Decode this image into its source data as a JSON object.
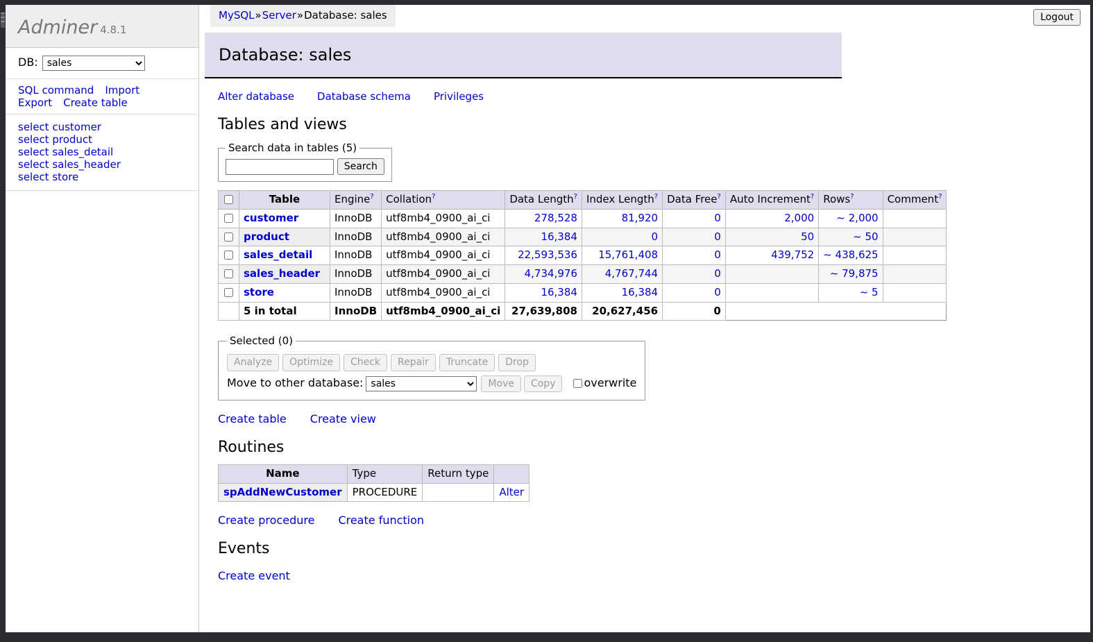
{
  "breadcrumb": {
    "server_type": "MySQL",
    "server": "Server",
    "separator": "»",
    "current": "Database: sales"
  },
  "logout_label": "Logout",
  "sidebar": {
    "logo_name": "Adminer",
    "logo_version": "4.8.1",
    "db_label": "DB:",
    "db_selected": "sales",
    "db_options": [
      "sales"
    ],
    "actions": [
      {
        "label": "SQL command"
      },
      {
        "label": "Import"
      },
      {
        "label": "Export"
      },
      {
        "label": "Create table"
      }
    ],
    "table_links": [
      {
        "label": "select customer"
      },
      {
        "label": "select product"
      },
      {
        "label": "select sales_detail"
      },
      {
        "label": "select sales_header"
      },
      {
        "label": "select store"
      }
    ]
  },
  "main": {
    "page_title": "Database: sales",
    "db_links": [
      {
        "label": "Alter database"
      },
      {
        "label": "Database schema"
      },
      {
        "label": "Privileges"
      }
    ],
    "tables_heading": "Tables and views",
    "search": {
      "legend": "Search data in tables (5)",
      "value": "",
      "button": "Search"
    },
    "tables_table": {
      "headers": [
        {
          "label": "Table",
          "help": false
        },
        {
          "label": "Engine",
          "help": true
        },
        {
          "label": "Collation",
          "help": true
        },
        {
          "label": "Data Length",
          "help": true
        },
        {
          "label": "Index Length",
          "help": true
        },
        {
          "label": "Data Free",
          "help": true
        },
        {
          "label": "Auto Increment",
          "help": true
        },
        {
          "label": "Rows",
          "help": true
        },
        {
          "label": "Comment",
          "help": true
        }
      ],
      "rows": [
        {
          "name": "customer",
          "engine": "InnoDB",
          "collation": "utf8mb4_0900_ai_ci",
          "data_length": "278,528",
          "index_length": "81,920",
          "data_free": "0",
          "auto_increment": "2,000",
          "rows": "~ 2,000",
          "comment": ""
        },
        {
          "name": "product",
          "engine": "InnoDB",
          "collation": "utf8mb4_0900_ai_ci",
          "data_length": "16,384",
          "index_length": "0",
          "data_free": "0",
          "auto_increment": "50",
          "rows": "~ 50",
          "comment": ""
        },
        {
          "name": "sales_detail",
          "engine": "InnoDB",
          "collation": "utf8mb4_0900_ai_ci",
          "data_length": "22,593,536",
          "index_length": "15,761,408",
          "data_free": "0",
          "auto_increment": "439,752",
          "rows": "~ 438,625",
          "comment": ""
        },
        {
          "name": "sales_header",
          "engine": "InnoDB",
          "collation": "utf8mb4_0900_ai_ci",
          "data_length": "4,734,976",
          "index_length": "4,767,744",
          "data_free": "0",
          "auto_increment": "",
          "rows": "~ 79,875",
          "comment": ""
        },
        {
          "name": "store",
          "engine": "InnoDB",
          "collation": "utf8mb4_0900_ai_ci",
          "data_length": "16,384",
          "index_length": "16,384",
          "data_free": "0",
          "auto_increment": "",
          "rows": "~ 5",
          "comment": ""
        }
      ],
      "total": {
        "name": "5 in total",
        "engine": "InnoDB",
        "collation": "utf8mb4_0900_ai_ci",
        "data_length": "27,639,808",
        "index_length": "20,627,456",
        "data_free": "0"
      }
    },
    "selected": {
      "legend": "Selected (0)",
      "buttons": [
        "Analyze",
        "Optimize",
        "Check",
        "Repair",
        "Truncate",
        "Drop"
      ],
      "move_label": "Move to other database:",
      "move_selected": "sales",
      "move_options": [
        "sales"
      ],
      "move_button": "Move",
      "copy_button": "Copy",
      "overwrite_label": "overwrite"
    },
    "create_links": [
      {
        "label": "Create table"
      },
      {
        "label": "Create view"
      }
    ],
    "routines_heading": "Routines",
    "routines_table": {
      "headers": [
        "Name",
        "Type",
        "Return type",
        ""
      ],
      "rows": [
        {
          "name": "spAddNewCustomer",
          "type": "PROCEDURE",
          "return_type": "",
          "action": "Alter"
        }
      ]
    },
    "routine_links": [
      {
        "label": "Create procedure"
      },
      {
        "label": "Create function"
      }
    ],
    "events_heading": "Events",
    "event_links": [
      {
        "label": "Create event"
      }
    ]
  },
  "colors": {
    "accent_orange": "#e8602c",
    "header_lavender": "#ddddee",
    "link_blue": "#0000cc",
    "frame_dark": "#2b2b31"
  }
}
